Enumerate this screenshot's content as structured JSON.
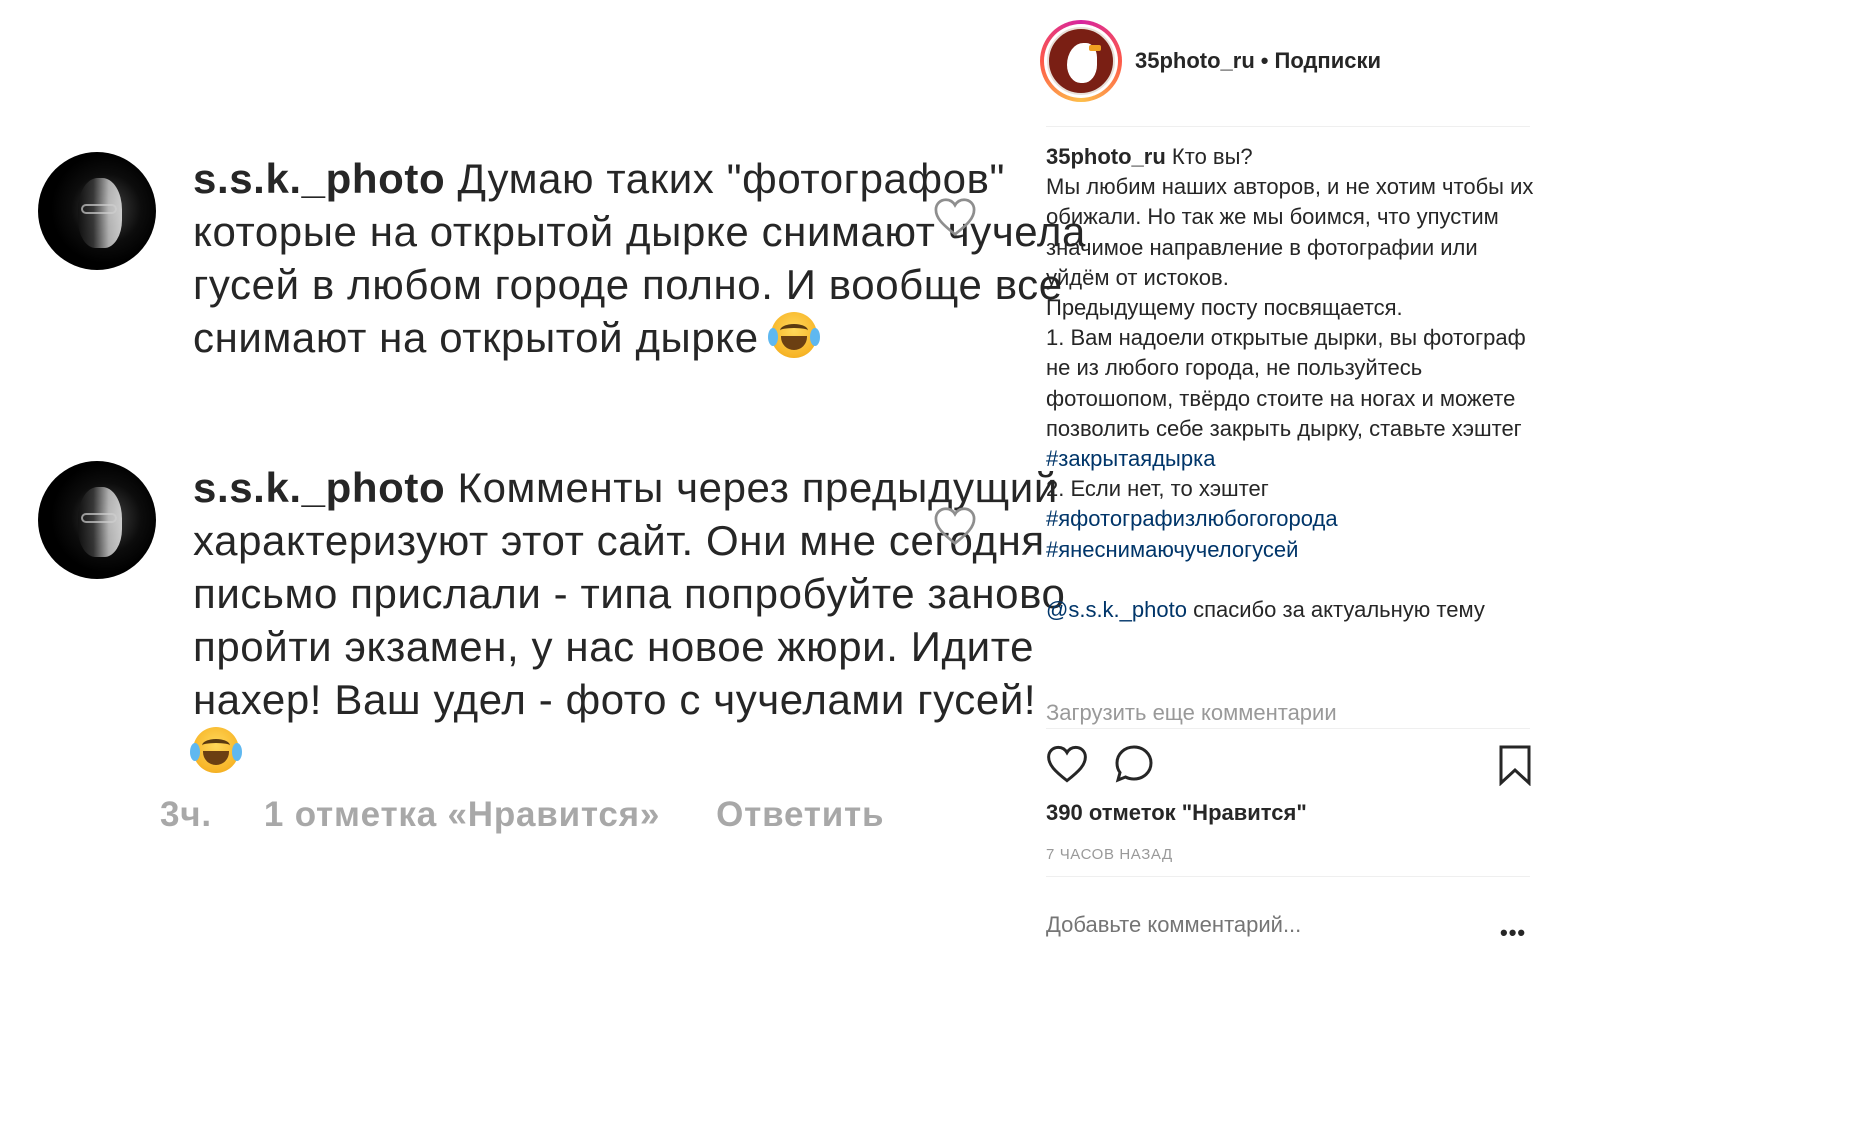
{
  "comments": [
    {
      "username": "s.s.k._photo",
      "text": "Думаю таких \"фотографов\" которые на открытой дырке снимают чучела гусей в любом городе полно. И вообще все снимают на открытой дырке",
      "emoji": "face-with-tears-of-joy"
    },
    {
      "username": "s.s.k._photo",
      "text": "Комменты через предыдущий характеризуют этот сайт. Они мне сегодня письмо прислали - типа попробуйте заново пройти экзамен, у нас новое жюри. Идите нахер! Ваш удел - фото с чучелами гусей!",
      "emoji": "face-with-tears-of-joy",
      "time": "3ч.",
      "likes": "1 отметка «Нравится»",
      "reply": "Ответить"
    }
  ],
  "post": {
    "account": "35photo_ru",
    "separator": "•",
    "follow_label": "Подписки",
    "caption_user": "35photo_ru",
    "caption_lines": [
      "Кто вы?",
      "Мы любим наших авторов, и не хотим чтобы их обижали. Но так же мы боимся, что упустим значимое направление в фотографии или уйдём от истоков.",
      "Предыдущему посту посвящается.",
      "1. Вам надоели открытые дырки, вы фотограф не из любого города, не пользуйтесь фотошопом, твёрдо стоите на ногах и можете позволить себе закрыть дырку, ставьте хэштег"
    ],
    "hashtag_1": "#закрытаядырка",
    "option_2": "2. Если нет, то хэштег",
    "hashtag_2": "#яфотографизлюбогогорода",
    "hashtag_3": "#янеснимаючучелогусей",
    "mention": "@s.s.k._photo",
    "mention_text": "спасибо за актуальную тему",
    "load_more": "Загрузить еще комментарии",
    "likes": "390 отметок \"Нравится\"",
    "time_ago": "7 ЧАСОВ НАЗАД",
    "add_comment_placeholder": "Добавьте комментарий...",
    "more_label": "•••"
  }
}
